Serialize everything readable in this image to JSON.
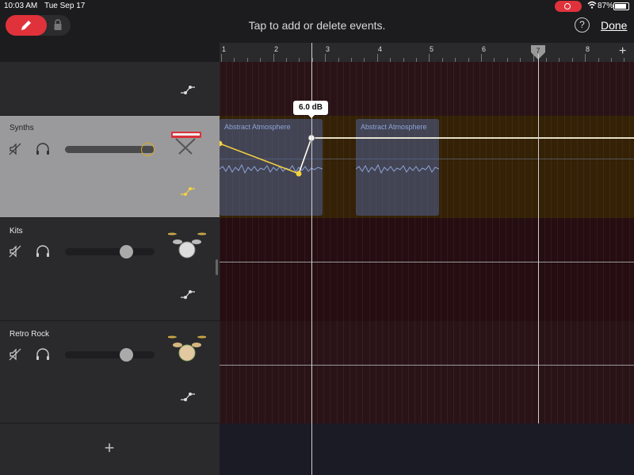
{
  "status": {
    "time": "10:03 AM",
    "date": "Tue Sep 17",
    "battery": "87%"
  },
  "toolbar": {
    "hint": "Tap to add or delete events.",
    "help": "?",
    "done": "Done"
  },
  "ruler": {
    "bars": [
      "1",
      "2",
      "3",
      "4",
      "5",
      "6",
      "7",
      "8"
    ],
    "add": "+"
  },
  "tracks": [
    {
      "name": ""
    },
    {
      "name": "Synths",
      "volume": 0.92
    },
    {
      "name": "Kits",
      "volume": 0.68
    },
    {
      "name": "Retro Rock",
      "volume": 0.68
    }
  ],
  "regions": [
    {
      "title": "Abstract Atmosphere"
    },
    {
      "title": "Abstract Atmosphere"
    }
  ],
  "automation": {
    "value_label": "6.0 dB"
  },
  "add_track": "+",
  "colors": {
    "accent": "#e0323b",
    "automation": "#f5d23c",
    "region": "#4e6296"
  }
}
